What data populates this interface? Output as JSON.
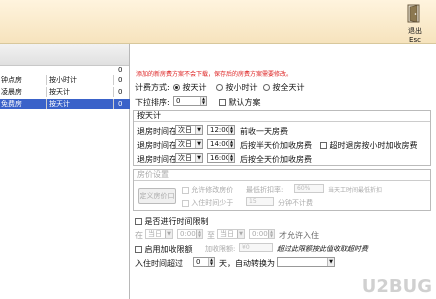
{
  "toolbar": {
    "exit_label": "退出",
    "exit_sub": "Esc"
  },
  "left_list": {
    "rows": [
      {
        "c1": "钟点房",
        "c2": "按小时计",
        "c3": "0",
        "selected": false
      },
      {
        "c1": "凌晨房",
        "c2": "按天计",
        "c3": "0",
        "selected": false
      },
      {
        "c1": "免费房",
        "c2": "按天计",
        "c3": "0",
        "selected": true
      }
    ],
    "extra_zeros": [
      "0",
      "0"
    ]
  },
  "form": {
    "warning": "添加的新房费方案不会下载，保存后的房费方案需要修改。",
    "billing_label": "计费方式:",
    "billing_options": [
      "按天计",
      "按小时计",
      "按全天计"
    ],
    "billing_selected": 0,
    "sort_label": "下拉排序:",
    "sort_value": "0",
    "default_scheme": "默认方案",
    "day_group_title": "按天计",
    "rule1": {
      "prefix": "退房时间在",
      "day": "次日",
      "time": "12:00",
      "suffix": "前收一天房费"
    },
    "rule2": {
      "prefix": "退房时间在",
      "day": "次日",
      "time": "14:00",
      "suffix": "后按半天价加收房费"
    },
    "rule2_extra": "超时退房按小时加收房费",
    "rule3": {
      "prefix": "退房时间在",
      "day": "次日",
      "time": "16:00",
      "suffix": "后按全天价加收房费"
    },
    "price_group_title": "房价设置",
    "price_btn": "定义房价口",
    "allow_discount": "允许修改房价",
    "min_discount_label": "最低折扣率:",
    "min_discount_value": "60%",
    "min_discount_hint": "当天工时间最低折扣",
    "checkin_limit": "入住时间少于",
    "checkin_limit_value": "15",
    "checkin_limit_suffix": "分钟不计费",
    "time_limit": "是否进行时间限制",
    "time_limit_from_prefix": "在",
    "time_limit_day1": "当日",
    "time_limit_time1": "0:00",
    "time_limit_to": "至",
    "time_limit_day2": "当日",
    "time_limit_time2": "0:00",
    "time_limit_suffix": "才允许入住",
    "enable_surcharge": "启用加收限额",
    "surcharge_label": "加收限额:",
    "surcharge_value": "¥0",
    "surcharge_hint": "超过此限额按此值收取超时费",
    "bottom_prefix": "入住时间超过",
    "bottom_value": "0",
    "bottom_mid": "天，自动转换为",
    "bottom_select": ""
  },
  "watermark": "U2BUG"
}
